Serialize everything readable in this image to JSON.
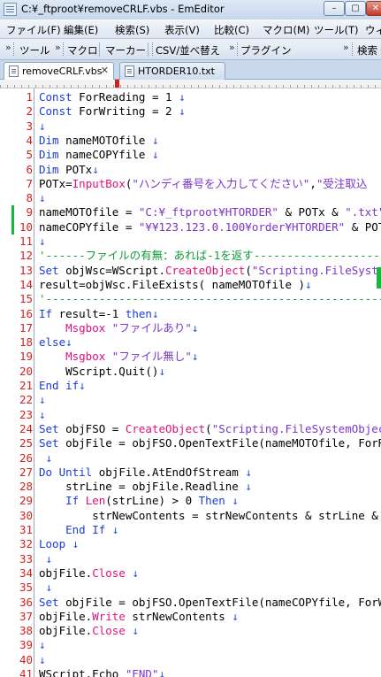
{
  "window": {
    "title": "C:¥_ftproot¥removeCRLF.vbs - EmEditor",
    "minimize": "–",
    "maximize": "▢",
    "close": "✕"
  },
  "menu": [
    "ファイル(F)",
    "編集(E)",
    "検索(S)",
    "表示(V)",
    "比較(C)",
    "マクロ(M)",
    "ツール(T)",
    "ウィ"
  ],
  "toolbar": {
    "items": [
      "ツール",
      "マクロ",
      "マーカー",
      "CSV/並べ替え",
      "プラグイン",
      "検索"
    ],
    "overflow": "»"
  },
  "tabs": [
    {
      "label": "removeCRLF.vbs",
      "close": "✕"
    },
    {
      "label": "HTORDER10.txt"
    }
  ],
  "lines": [
    {
      "n": "1",
      "segs": [
        [
          "kw",
          "Const"
        ],
        [
          "nm",
          " ForReading = 1 "
        ],
        [
          "mk",
          "↓"
        ]
      ]
    },
    {
      "n": "2",
      "segs": [
        [
          "kw",
          "Const"
        ],
        [
          "nm",
          " ForWriting = 2 "
        ],
        [
          "mk",
          "↓"
        ]
      ]
    },
    {
      "n": "3",
      "segs": [
        [
          "mk",
          "↓"
        ]
      ]
    },
    {
      "n": "4",
      "segs": [
        [
          "kw",
          "Dim"
        ],
        [
          "nm",
          " nameMOTOfile "
        ],
        [
          "mk",
          "↓"
        ]
      ]
    },
    {
      "n": "5",
      "segs": [
        [
          "kw",
          "Dim"
        ],
        [
          "nm",
          " nameCOPYfile "
        ],
        [
          "mk",
          "↓"
        ]
      ]
    },
    {
      "n": "6",
      "segs": [
        [
          "kw",
          "Dim"
        ],
        [
          "nm",
          " POTx"
        ],
        [
          "mk",
          "↓"
        ]
      ]
    },
    {
      "n": "7",
      "segs": [
        [
          "nm",
          "POTx="
        ],
        [
          "fn",
          "InputBox"
        ],
        [
          "nm",
          "("
        ],
        [
          "str",
          "\"ハンディ番号を入力してください\""
        ],
        [
          "nm",
          ","
        ],
        [
          "str",
          "\"受注取込"
        ]
      ]
    },
    {
      "n": "8",
      "segs": [
        [
          "mk",
          "↓"
        ]
      ]
    },
    {
      "n": "9",
      "segs": [
        [
          "nm",
          "nameMOTOfile = "
        ],
        [
          "str",
          "\"C:¥_ftproot¥HTORDER\""
        ],
        [
          "nm",
          " & POTx & "
        ],
        [
          "str",
          "\".txt\""
        ]
      ],
      "changed": true
    },
    {
      "n": "10",
      "segs": [
        [
          "nm",
          "nameCOPYfile = "
        ],
        [
          "str",
          "\"¥¥123.123.0.100¥order¥HTORDER\""
        ],
        [
          "nm",
          " & POTx"
        ]
      ],
      "changed": true
    },
    {
      "n": "11",
      "segs": [
        [
          "mk",
          "↓"
        ]
      ]
    },
    {
      "n": "12",
      "segs": [
        [
          "cm",
          "'------ファイルの有無：あれば-1を返す--------------------"
        ]
      ]
    },
    {
      "n": "13",
      "segs": [
        [
          "kw",
          "Set"
        ],
        [
          "nm",
          " objWsc=WScript."
        ],
        [
          "fn",
          "CreateObject"
        ],
        [
          "nm",
          "("
        ],
        [
          "str",
          "\"Scripting.FileSystemOb"
        ]
      ]
    },
    {
      "n": "14",
      "segs": [
        [
          "nm",
          "result=objWsc.FileExists( nameMOTOfile )"
        ],
        [
          "mk",
          "↓"
        ]
      ]
    },
    {
      "n": "15",
      "segs": [
        [
          "cm",
          "'-------------------------------------------------------"
        ]
      ]
    },
    {
      "n": "16",
      "segs": [
        [
          "kw",
          "If"
        ],
        [
          "nm",
          " result=-1 "
        ],
        [
          "kw",
          "then"
        ],
        [
          "mk",
          "↓"
        ]
      ]
    },
    {
      "n": "17",
      "segs": [
        [
          "nm",
          "    "
        ],
        [
          "fn",
          "Msgbox"
        ],
        [
          "nm",
          " "
        ],
        [
          "str",
          "\"ファイルあり\""
        ],
        [
          "mk",
          "↓"
        ]
      ]
    },
    {
      "n": "18",
      "segs": [
        [
          "kw",
          "else"
        ],
        [
          "mk",
          "↓"
        ]
      ]
    },
    {
      "n": "19",
      "segs": [
        [
          "nm",
          "    "
        ],
        [
          "fn",
          "Msgbox"
        ],
        [
          "nm",
          " "
        ],
        [
          "str",
          "\"ファイル無し\""
        ],
        [
          "mk",
          "↓"
        ]
      ]
    },
    {
      "n": "20",
      "segs": [
        [
          "nm",
          "    WScript.Quit()"
        ],
        [
          "mk",
          "↓"
        ]
      ]
    },
    {
      "n": "21",
      "segs": [
        [
          "kw",
          "End if"
        ],
        [
          "mk",
          "↓"
        ]
      ]
    },
    {
      "n": "22",
      "segs": [
        [
          "mk",
          "↓"
        ]
      ]
    },
    {
      "n": "23",
      "segs": [
        [
          "mk",
          "↓"
        ]
      ]
    },
    {
      "n": "24",
      "segs": [
        [
          "kw",
          "Set"
        ],
        [
          "nm",
          " objFSO = "
        ],
        [
          "fn",
          "CreateObject"
        ],
        [
          "nm",
          "("
        ],
        [
          "str",
          "\"Scripting.FileSystemObject\""
        ],
        [
          "nm",
          ")"
        ]
      ]
    },
    {
      "n": "25",
      "segs": [
        [
          "kw",
          "Set"
        ],
        [
          "nm",
          " objFile = objFSO.OpenTextFile(nameMOTOfile, ForRead"
        ]
      ]
    },
    {
      "n": "26",
      "segs": [
        [
          "nm",
          " "
        ],
        [
          "mk",
          "↓"
        ]
      ]
    },
    {
      "n": "27",
      "segs": [
        [
          "kw",
          "Do Until"
        ],
        [
          "nm",
          " objFile.AtEndOfStream "
        ],
        [
          "mk",
          "↓"
        ]
      ]
    },
    {
      "n": "28",
      "segs": [
        [
          "nm",
          "    strLine = objFile.Readline "
        ],
        [
          "mk",
          "↓"
        ]
      ]
    },
    {
      "n": "29",
      "segs": [
        [
          "nm",
          "    "
        ],
        [
          "kw",
          "If"
        ],
        [
          "nm",
          " "
        ],
        [
          "fn",
          "Len"
        ],
        [
          "nm",
          "(strLine) > 0 "
        ],
        [
          "kw",
          "Then"
        ],
        [
          "nm",
          " "
        ],
        [
          "mk",
          "↓"
        ]
      ]
    },
    {
      "n": "30",
      "segs": [
        [
          "nm",
          "        strNewContents = strNewContents & strLine & vbC"
        ]
      ]
    },
    {
      "n": "31",
      "segs": [
        [
          "nm",
          "    "
        ],
        [
          "kw",
          "End If"
        ],
        [
          "nm",
          " "
        ],
        [
          "mk",
          "↓"
        ]
      ]
    },
    {
      "n": "32",
      "segs": [
        [
          "kw",
          "Loop"
        ],
        [
          "nm",
          " "
        ],
        [
          "mk",
          "↓"
        ]
      ]
    },
    {
      "n": "33",
      "segs": [
        [
          "nm",
          " "
        ],
        [
          "mk",
          "↓"
        ]
      ]
    },
    {
      "n": "34",
      "segs": [
        [
          "nm",
          "objFile."
        ],
        [
          "fn",
          "Close"
        ],
        [
          "nm",
          " "
        ],
        [
          "mk",
          "↓"
        ]
      ]
    },
    {
      "n": "35",
      "segs": [
        [
          "nm",
          " "
        ],
        [
          "mk",
          "↓"
        ]
      ]
    },
    {
      "n": "36",
      "segs": [
        [
          "kw",
          "Set"
        ],
        [
          "nm",
          " objFile = objFSO.OpenTextFile(nameCOPYfile, ForWrit"
        ]
      ]
    },
    {
      "n": "37",
      "segs": [
        [
          "nm",
          "objFile."
        ],
        [
          "fn",
          "Write"
        ],
        [
          "nm",
          " strNewContents "
        ],
        [
          "mk",
          "↓"
        ]
      ]
    },
    {
      "n": "38",
      "segs": [
        [
          "nm",
          "objFile."
        ],
        [
          "fn",
          "Close"
        ],
        [
          "nm",
          " "
        ],
        [
          "mk",
          "↓"
        ]
      ]
    },
    {
      "n": "39",
      "segs": [
        [
          "mk",
          "↓"
        ]
      ]
    },
    {
      "n": "40",
      "segs": [
        [
          "mk",
          "↓"
        ]
      ]
    },
    {
      "n": "41",
      "segs": [
        [
          "nm",
          "WScript.Echo "
        ],
        [
          "str",
          "\"END\""
        ],
        [
          "mk",
          "↓"
        ]
      ]
    }
  ]
}
